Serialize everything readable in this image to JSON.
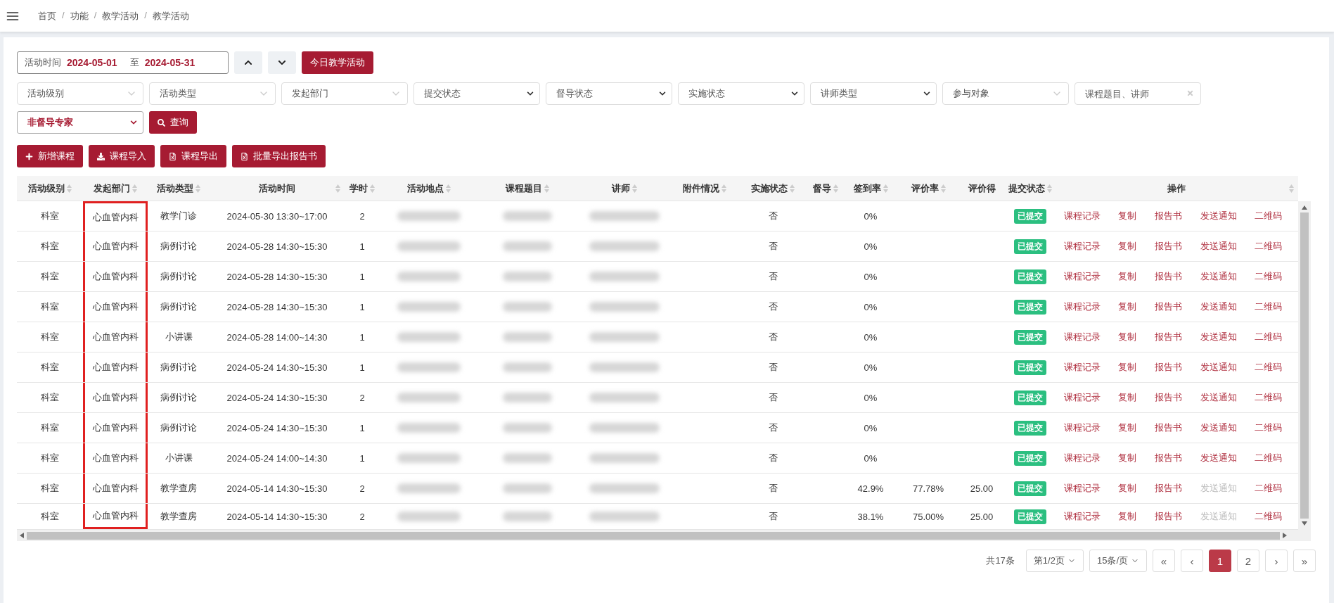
{
  "breadcrumb": {
    "separator": "/",
    "items": [
      "首页",
      "功能",
      "教学活动",
      "教学活动"
    ]
  },
  "date_range": {
    "label": "活动时间",
    "start": "2024-05-01",
    "separator": "至",
    "end": "2024-05-31"
  },
  "today_button": "今日教学活动",
  "filters": [
    {
      "kind": "combo",
      "placeholder": "活动级别"
    },
    {
      "kind": "combo",
      "placeholder": "活动类型"
    },
    {
      "kind": "combo",
      "placeholder": "发起部门"
    },
    {
      "kind": "select",
      "placeholder": "提交状态"
    },
    {
      "kind": "select",
      "placeholder": "督导状态"
    },
    {
      "kind": "select",
      "placeholder": "实施状态"
    },
    {
      "kind": "select",
      "placeholder": "讲师类型"
    },
    {
      "kind": "combo",
      "placeholder": "参与对象"
    },
    {
      "kind": "search",
      "placeholder": "课程题目、讲师"
    }
  ],
  "role_select": "非督导专家",
  "query_button": "查询",
  "actions": [
    {
      "kind": "add",
      "label": "新增课程"
    },
    {
      "kind": "import",
      "label": "课程导入"
    },
    {
      "kind": "export",
      "label": "课程导出"
    },
    {
      "kind": "export",
      "label": "批量导出报告书"
    }
  ],
  "table": {
    "columns": [
      {
        "label": "活动级别",
        "kind": "text",
        "highlighted": false
      },
      {
        "label": "发起部门",
        "kind": "text",
        "highlighted": true
      },
      {
        "label": "活动类型",
        "kind": "text",
        "highlighted": false
      },
      {
        "label": "活动时间",
        "kind": "text",
        "highlighted": false
      },
      {
        "label": "学时",
        "kind": "text",
        "highlighted": false
      },
      {
        "label": "活动地点",
        "kind": "blurred",
        "highlighted": false
      },
      {
        "label": "课程题目",
        "kind": "blurred",
        "highlighted": false
      },
      {
        "label": "讲师",
        "kind": "blurred",
        "highlighted": false
      },
      {
        "label": "附件情况",
        "kind": "text",
        "highlighted": false
      },
      {
        "label": "实施状态",
        "kind": "text",
        "highlighted": false
      },
      {
        "label": "督导",
        "kind": "text",
        "highlighted": false
      },
      {
        "label": "签到率",
        "kind": "text",
        "highlighted": false
      },
      {
        "label": "评价率",
        "kind": "text",
        "highlighted": false
      },
      {
        "label": "评价得",
        "kind": "text",
        "highlighted": false
      },
      {
        "label": "提交状态",
        "kind": "badge",
        "highlighted": false
      },
      {
        "label": "操作",
        "kind": "actions",
        "highlighted": false
      }
    ],
    "rows": [
      {
        "cells": [
          "科室",
          "心血管内科",
          "教学门诊",
          "2024-05-30 13:30~17:00",
          "2",
          "",
          "",
          "",
          "",
          "否",
          "",
          "0%",
          "",
          "",
          "已提交"
        ],
        "actions": [
          {
            "label": "课程记录",
            "disabled": false
          },
          {
            "label": "复制",
            "disabled": false
          },
          {
            "label": "报告书",
            "disabled": false
          },
          {
            "label": "发送通知",
            "disabled": false
          },
          {
            "label": "二维码",
            "disabled": false
          }
        ]
      },
      {
        "cells": [
          "科室",
          "心血管内科",
          "病例讨论",
          "2024-05-28 14:30~15:30",
          "1",
          "",
          "",
          "",
          "",
          "否",
          "",
          "0%",
          "",
          "",
          "已提交"
        ],
        "actions": [
          {
            "label": "课程记录",
            "disabled": false
          },
          {
            "label": "复制",
            "disabled": false
          },
          {
            "label": "报告书",
            "disabled": false
          },
          {
            "label": "发送通知",
            "disabled": false
          },
          {
            "label": "二维码",
            "disabled": false
          }
        ]
      },
      {
        "cells": [
          "科室",
          "心血管内科",
          "病例讨论",
          "2024-05-28 14:30~15:30",
          "1",
          "",
          "",
          "",
          "",
          "否",
          "",
          "0%",
          "",
          "",
          "已提交"
        ],
        "actions": [
          {
            "label": "课程记录",
            "disabled": false
          },
          {
            "label": "复制",
            "disabled": false
          },
          {
            "label": "报告书",
            "disabled": false
          },
          {
            "label": "发送通知",
            "disabled": false
          },
          {
            "label": "二维码",
            "disabled": false
          }
        ]
      },
      {
        "cells": [
          "科室",
          "心血管内科",
          "病例讨论",
          "2024-05-28 14:30~15:30",
          "1",
          "",
          "",
          "",
          "",
          "否",
          "",
          "0%",
          "",
          "",
          "已提交"
        ],
        "actions": [
          {
            "label": "课程记录",
            "disabled": false
          },
          {
            "label": "复制",
            "disabled": false
          },
          {
            "label": "报告书",
            "disabled": false
          },
          {
            "label": "发送通知",
            "disabled": false
          },
          {
            "label": "二维码",
            "disabled": false
          }
        ]
      },
      {
        "cells": [
          "科室",
          "心血管内科",
          "小讲课",
          "2024-05-28 14:00~14:30",
          "1",
          "",
          "",
          "",
          "",
          "否",
          "",
          "0%",
          "",
          "",
          "已提交"
        ],
        "actions": [
          {
            "label": "课程记录",
            "disabled": false
          },
          {
            "label": "复制",
            "disabled": false
          },
          {
            "label": "报告书",
            "disabled": false
          },
          {
            "label": "发送通知",
            "disabled": false
          },
          {
            "label": "二维码",
            "disabled": false
          }
        ]
      },
      {
        "cells": [
          "科室",
          "心血管内科",
          "病例讨论",
          "2024-05-24 14:30~15:30",
          "1",
          "",
          "",
          "",
          "",
          "否",
          "",
          "0%",
          "",
          "",
          "已提交"
        ],
        "actions": [
          {
            "label": "课程记录",
            "disabled": false
          },
          {
            "label": "复制",
            "disabled": false
          },
          {
            "label": "报告书",
            "disabled": false
          },
          {
            "label": "发送通知",
            "disabled": false
          },
          {
            "label": "二维码",
            "disabled": false
          }
        ]
      },
      {
        "cells": [
          "科室",
          "心血管内科",
          "病例讨论",
          "2024-05-24 14:30~15:30",
          "2",
          "",
          "",
          "",
          "",
          "否",
          "",
          "0%",
          "",
          "",
          "已提交"
        ],
        "actions": [
          {
            "label": "课程记录",
            "disabled": false
          },
          {
            "label": "复制",
            "disabled": false
          },
          {
            "label": "报告书",
            "disabled": false
          },
          {
            "label": "发送通知",
            "disabled": false
          },
          {
            "label": "二维码",
            "disabled": false
          }
        ]
      },
      {
        "cells": [
          "科室",
          "心血管内科",
          "病例讨论",
          "2024-05-24 14:30~15:30",
          "1",
          "",
          "",
          "",
          "",
          "否",
          "",
          "0%",
          "",
          "",
          "已提交"
        ],
        "actions": [
          {
            "label": "课程记录",
            "disabled": false
          },
          {
            "label": "复制",
            "disabled": false
          },
          {
            "label": "报告书",
            "disabled": false
          },
          {
            "label": "发送通知",
            "disabled": false
          },
          {
            "label": "二维码",
            "disabled": false
          }
        ]
      },
      {
        "cells": [
          "科室",
          "心血管内科",
          "小讲课",
          "2024-05-24 14:00~14:30",
          "1",
          "",
          "",
          "",
          "",
          "否",
          "",
          "0%",
          "",
          "",
          "已提交"
        ],
        "actions": [
          {
            "label": "课程记录",
            "disabled": false
          },
          {
            "label": "复制",
            "disabled": false
          },
          {
            "label": "报告书",
            "disabled": false
          },
          {
            "label": "发送通知",
            "disabled": false
          },
          {
            "label": "二维码",
            "disabled": false
          }
        ]
      },
      {
        "cells": [
          "科室",
          "心血管内科",
          "教学查房",
          "2024-05-14 14:30~15:30",
          "2",
          "",
          "",
          "",
          "",
          "否",
          "",
          "42.9%",
          "77.78%",
          "25.00",
          "已提交"
        ],
        "actions": [
          {
            "label": "课程记录",
            "disabled": false
          },
          {
            "label": "复制",
            "disabled": false
          },
          {
            "label": "报告书",
            "disabled": false
          },
          {
            "label": "发送通知",
            "disabled": true
          },
          {
            "label": "二维码",
            "disabled": false
          }
        ]
      },
      {
        "cells": [
          "科室",
          "心血管内科",
          "教学查房",
          "2024-05-14 14:30~15:30",
          "2",
          "",
          "",
          "",
          "",
          "否",
          "",
          "38.1%",
          "75.00%",
          "25.00",
          "已提交"
        ],
        "actions": [
          {
            "label": "课程记录",
            "disabled": false
          },
          {
            "label": "复制",
            "disabled": false
          },
          {
            "label": "报告书",
            "disabled": false
          },
          {
            "label": "发送通知",
            "disabled": true
          },
          {
            "label": "二维码",
            "disabled": false
          }
        ]
      }
    ]
  },
  "pagination": {
    "total": "共17条",
    "page_select": "第1/2页",
    "size_select": "15条/页",
    "first": "«",
    "prev": "‹",
    "pages": [
      {
        "label": "1",
        "selected": true
      },
      {
        "label": "2",
        "selected": false
      }
    ],
    "next": "›",
    "last": "»"
  }
}
